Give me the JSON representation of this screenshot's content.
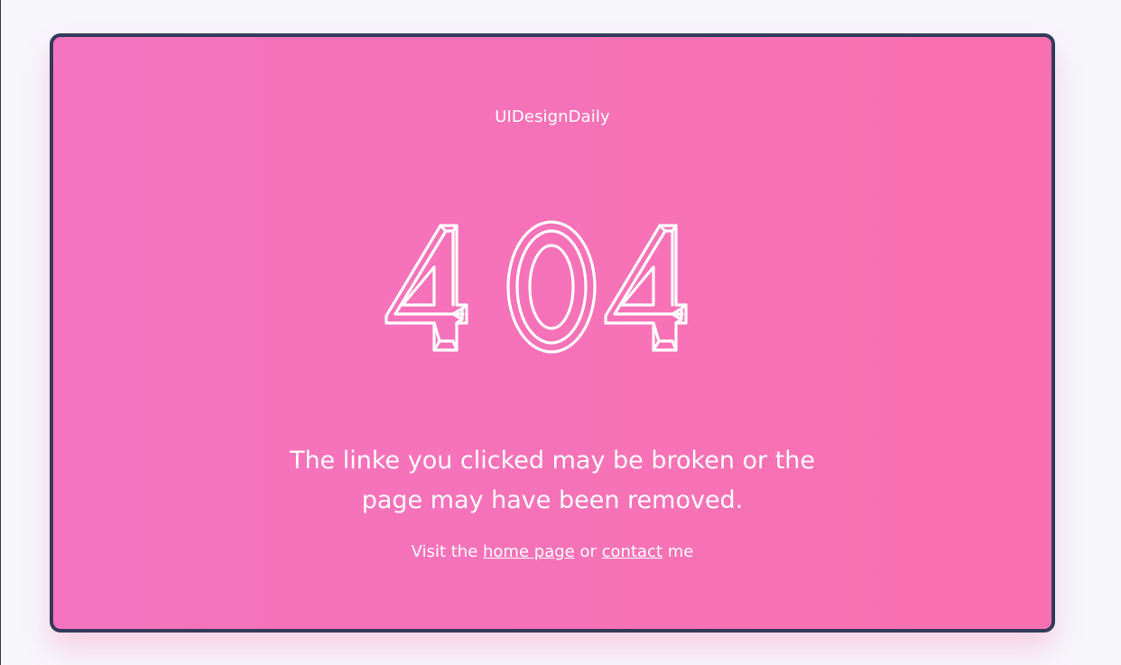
{
  "brand": {
    "name": "UIDesignDaily"
  },
  "hero": {
    "code_text": "404"
  },
  "message": {
    "line1": "The linke you clicked may be broken or the",
    "line2": "page may have been removed."
  },
  "links": {
    "prefix": "Visit the",
    "home_label": "home page",
    "middle": "or",
    "contact_label": "contact",
    "suffix": "me"
  },
  "colors": {
    "card_gradient_start": "#f574c0",
    "card_gradient_end": "#f870b0",
    "card_border": "#343a5a",
    "text": "#ffffff",
    "page_background": "#f7f6fb"
  }
}
